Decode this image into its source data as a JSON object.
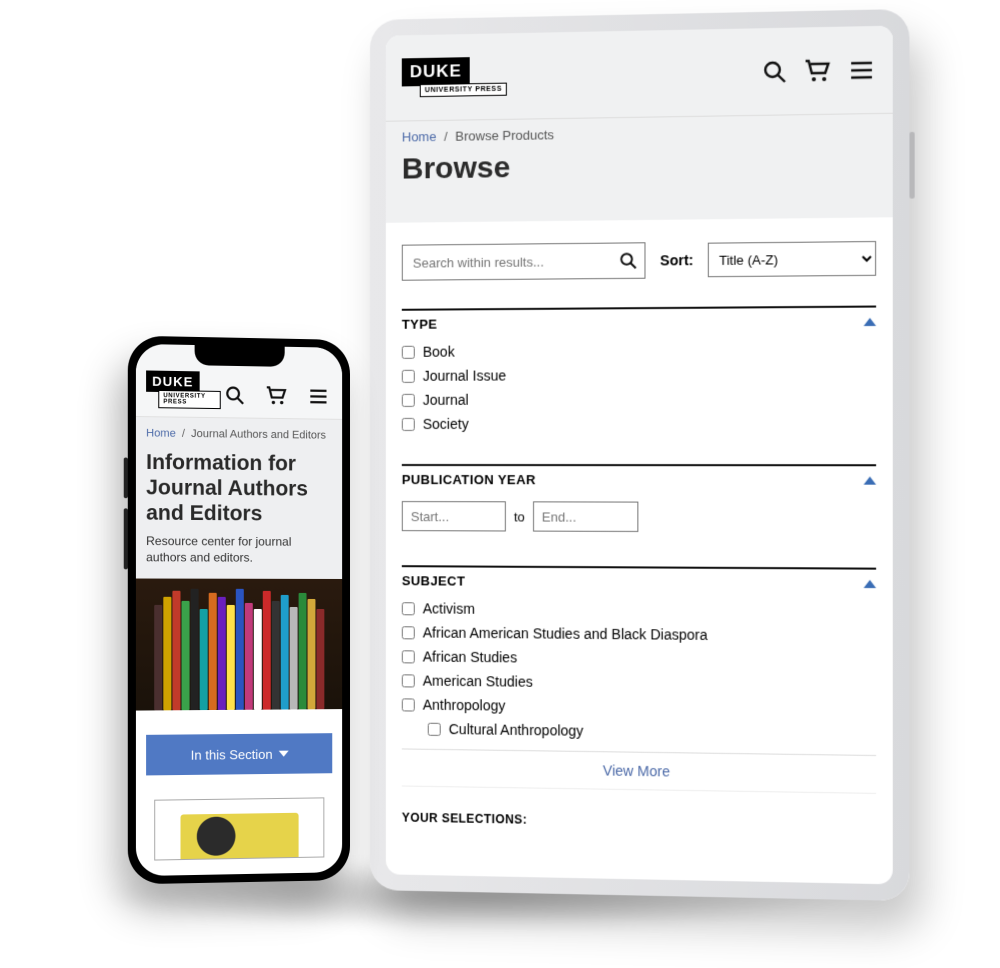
{
  "brand": {
    "top": "DUKE",
    "bottom": "UNIVERSITY PRESS"
  },
  "tablet": {
    "breadcrumb": {
      "home": "Home",
      "current": "Browse Products"
    },
    "title": "Browse",
    "search": {
      "placeholder": "Search within results..."
    },
    "sort": {
      "label": "Sort:",
      "value": "Title (A-Z)"
    },
    "facets": {
      "type": {
        "heading": "TYPE",
        "items": [
          "Book",
          "Journal Issue",
          "Journal",
          "Society"
        ]
      },
      "year": {
        "heading": "PUBLICATION YEAR",
        "start_ph": "Start...",
        "to": "to",
        "end_ph": "End..."
      },
      "subject": {
        "heading": "SUBJECT",
        "items": [
          "Activism",
          "African American Studies and Black Diaspora",
          "African Studies",
          "American Studies",
          "Anthropology"
        ],
        "sub": "Cultural Anthropology",
        "view_more": "View More"
      }
    },
    "your_selections": "YOUR SELECTIONS:"
  },
  "phone": {
    "breadcrumb": {
      "home": "Home",
      "current": "Journal Authors and Editors"
    },
    "title": "Information for Journal Authors and Editors",
    "subtitle": "Resource center for journal authors and editors.",
    "section_btn": "In this Section"
  }
}
